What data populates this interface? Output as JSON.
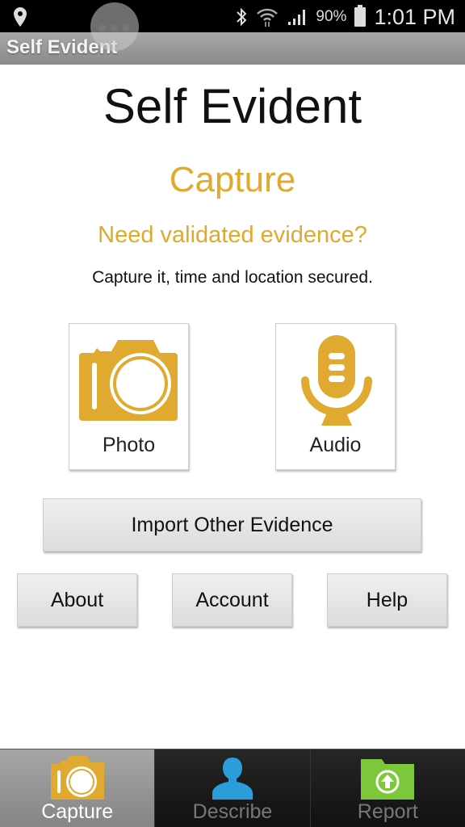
{
  "status_bar": {
    "battery_percent": "90%",
    "time": "1:01 PM",
    "icons": [
      "location-pin-icon",
      "overflow-bubble-icon",
      "bluetooth-icon",
      "wifi-icon",
      "signal-icon",
      "battery-icon"
    ]
  },
  "action_bar": {
    "title": "Self Evident"
  },
  "main": {
    "app_title": "Self Evident",
    "section_title": "Capture",
    "subtitle": "Need validated evidence?",
    "tagline": "Capture it, time and location secured.",
    "tiles": [
      {
        "label": "Photo",
        "icon": "camera-icon"
      },
      {
        "label": "Audio",
        "icon": "microphone-icon"
      }
    ],
    "import_button": "Import Other Evidence",
    "buttons": {
      "about": "About",
      "account": "Account",
      "help": "Help"
    }
  },
  "tabs": [
    {
      "label": "Capture",
      "icon": "camera-icon",
      "active": true
    },
    {
      "label": "Describe",
      "icon": "person-icon",
      "active": false
    },
    {
      "label": "Report",
      "icon": "folder-upload-icon",
      "active": false
    }
  ],
  "colors": {
    "accent": "#e0a930",
    "describe_blue": "#2a9ddb",
    "report_green": "#7dc83a"
  }
}
